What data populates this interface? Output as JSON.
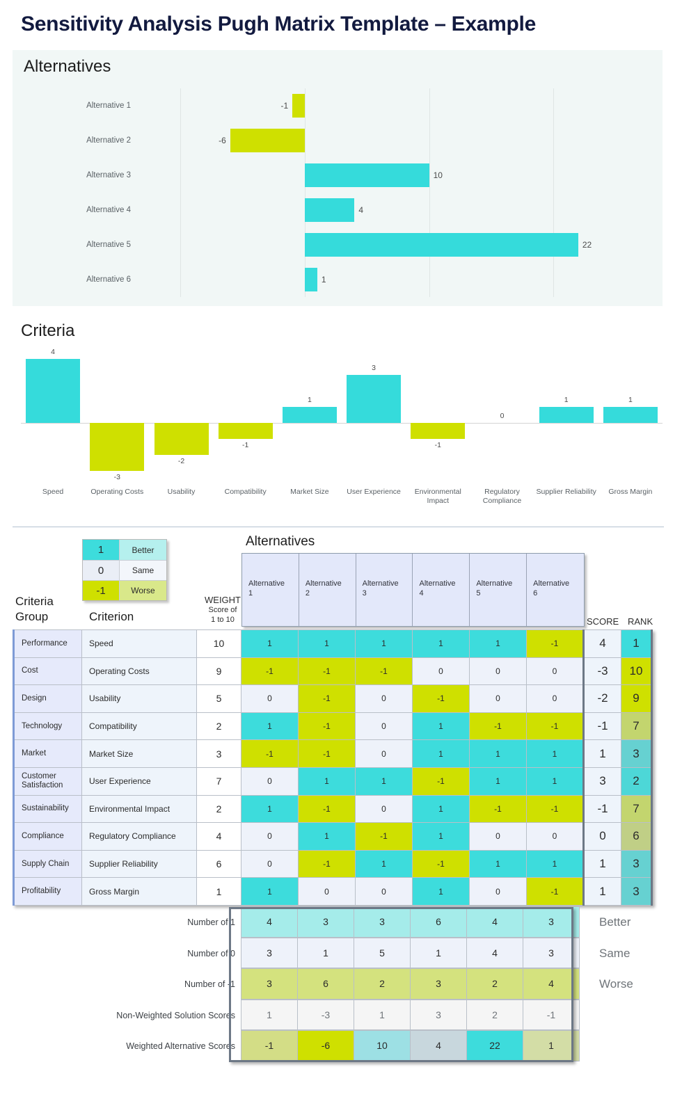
{
  "title": "Sensitivity Analysis Pugh Matrix Template – Example",
  "alternatives_panel": {
    "heading": "Alternatives"
  },
  "criteria_panel": {
    "heading": "Criteria"
  },
  "matrix_section": {
    "alternatives_label": "Alternatives",
    "criteria_group_header_line1": "Criteria",
    "criteria_group_header_line2": "Group",
    "criterion_header": "Criterion",
    "weight_header": "WEIGHT",
    "weight_sub1": "Score of",
    "weight_sub2": "1 to 10",
    "score_header": "SCORE",
    "rank_header": "RANK"
  },
  "legend": [
    {
      "value": "1",
      "label": "Better"
    },
    {
      "value": "0",
      "label": "Same"
    },
    {
      "value": "-1",
      "label": "Worse"
    }
  ],
  "alternative_headers": [
    "Alternative 1",
    "Alternative 2",
    "Alternative 3",
    "Alternative 4",
    "Alternative 5",
    "Alternative 6"
  ],
  "chart_data": [
    {
      "type": "bar",
      "title": "Alternatives",
      "orientation": "horizontal",
      "categories": [
        "Alternative 1",
        "Alternative 2",
        "Alternative 3",
        "Alternative 4",
        "Alternative 5",
        "Alternative 6"
      ],
      "values": [
        -1,
        -6,
        10,
        4,
        22,
        1
      ],
      "labels": [
        "-1",
        "-6",
        "10",
        "4",
        "22",
        "1"
      ],
      "xlabel": "",
      "ylabel": "",
      "xlim": [
        -14,
        28
      ],
      "gridlines": [
        -10,
        0,
        10,
        20
      ],
      "grid": true,
      "legend": "none",
      "colors": {
        "positive": "#35dbdb",
        "negative": "#cfe000"
      }
    },
    {
      "type": "bar",
      "title": "Criteria",
      "orientation": "vertical",
      "categories": [
        "Speed",
        "Operating Costs",
        "Usability",
        "Compatibility",
        "Market Size",
        "User Experience",
        "Environmental Impact",
        "Regulatory Compliance",
        "Supplier Reliability",
        "Gross Margin"
      ],
      "values": [
        4,
        -3,
        -2,
        -1,
        1,
        3,
        -1,
        0,
        1,
        1
      ],
      "labels": [
        "4",
        "-3",
        "-2",
        "-1",
        "1",
        "3",
        "-1",
        "0",
        "1",
        "1"
      ],
      "xlabel": "",
      "ylabel": "",
      "ylim": [
        -4,
        5
      ],
      "grid": false,
      "legend": "none",
      "colors": {
        "positive": "#35dbdb",
        "negative": "#cfe000"
      }
    }
  ],
  "matrix_rows": [
    {
      "group": "Performance",
      "criterion": "Speed",
      "weight": "10",
      "cells": [
        "1",
        "1",
        "1",
        "1",
        "1",
        "-1"
      ],
      "score": "4",
      "rank": "1"
    },
    {
      "group": "Cost",
      "criterion": "Operating Costs",
      "weight": "9",
      "cells": [
        "-1",
        "-1",
        "-1",
        "0",
        "0",
        "0"
      ],
      "score": "-3",
      "rank": "10"
    },
    {
      "group": "Design",
      "criterion": "Usability",
      "weight": "5",
      "cells": [
        "0",
        "-1",
        "0",
        "-1",
        "0",
        "0"
      ],
      "score": "-2",
      "rank": "9"
    },
    {
      "group": "Technology",
      "criterion": "Compatibility",
      "weight": "2",
      "cells": [
        "1",
        "-1",
        "0",
        "1",
        "-1",
        "-1"
      ],
      "score": "-1",
      "rank": "7"
    },
    {
      "group": "Market",
      "criterion": "Market Size",
      "weight": "3",
      "cells": [
        "-1",
        "-1",
        "0",
        "1",
        "1",
        "1"
      ],
      "score": "1",
      "rank": "3"
    },
    {
      "group": "Customer Satisfaction",
      "criterion": "User Experience",
      "weight": "7",
      "cells": [
        "0",
        "1",
        "1",
        "-1",
        "1",
        "1"
      ],
      "score": "3",
      "rank": "2"
    },
    {
      "group": "Sustainability",
      "criterion": "Environmental Impact",
      "weight": "2",
      "cells": [
        "1",
        "-1",
        "0",
        "1",
        "-1",
        "-1"
      ],
      "score": "-1",
      "rank": "7"
    },
    {
      "group": "Compliance",
      "criterion": "Regulatory Compliance",
      "weight": "4",
      "cells": [
        "0",
        "1",
        "-1",
        "1",
        "0",
        "0"
      ],
      "score": "0",
      "rank": "6"
    },
    {
      "group": "Supply Chain",
      "criterion": "Supplier Reliability",
      "weight": "6",
      "cells": [
        "0",
        "-1",
        "1",
        "-1",
        "1",
        "1"
      ],
      "score": "1",
      "rank": "3"
    },
    {
      "group": "Profitability",
      "criterion": "Gross Margin",
      "weight": "1",
      "cells": [
        "1",
        "0",
        "0",
        "1",
        "0",
        "-1"
      ],
      "score": "1",
      "rank": "3"
    }
  ],
  "summary_rows": [
    {
      "label": "Number of 1",
      "values": [
        "4",
        "3",
        "3",
        "6",
        "4",
        "3"
      ],
      "legend": "Better"
    },
    {
      "label": "Number of 0",
      "values": [
        "3",
        "1",
        "5",
        "1",
        "4",
        "3"
      ],
      "legend": "Same"
    },
    {
      "label": "Number of -1",
      "values": [
        "3",
        "6",
        "2",
        "3",
        "2",
        "4"
      ],
      "legend": "Worse"
    },
    {
      "label": "Non-Weighted Solution Scores",
      "values": [
        "1",
        "-3",
        "1",
        "3",
        "2",
        "-1"
      ],
      "legend": ""
    },
    {
      "label": "Weighted Alternative Scores",
      "values": [
        "-1",
        "-6",
        "10",
        "4",
        "22",
        "1"
      ],
      "legend": ""
    }
  ],
  "colors": {
    "cyan": "#35dbdb",
    "yellowgreen": "#cfe000",
    "title_navy": "#121a3f",
    "panel_bg": "#f1f7f6"
  }
}
